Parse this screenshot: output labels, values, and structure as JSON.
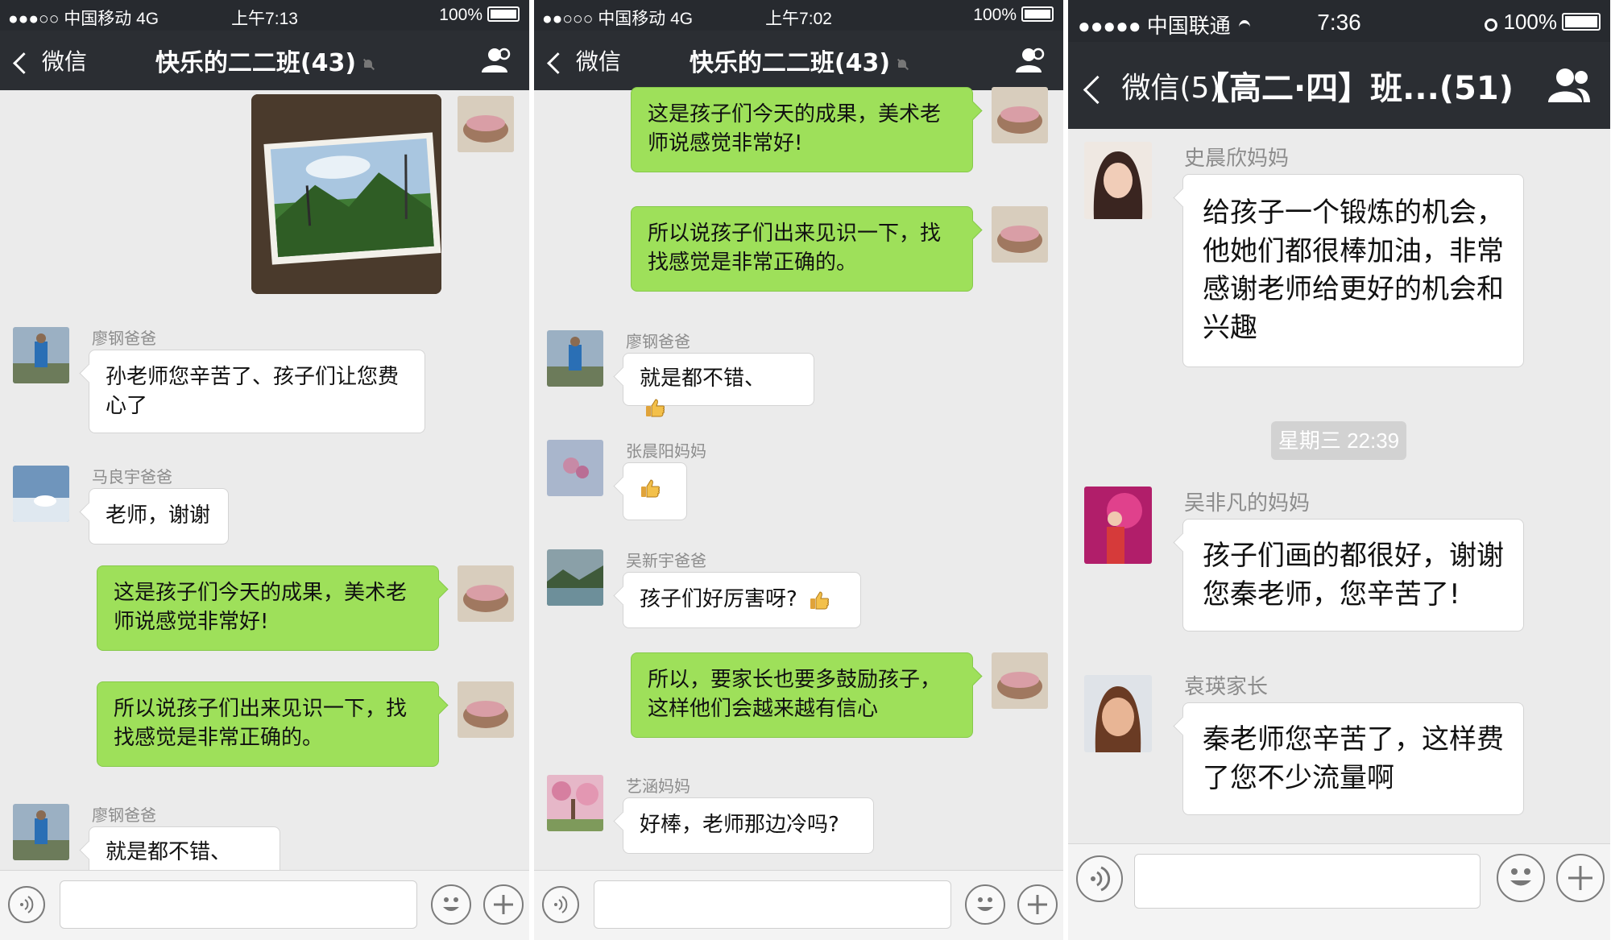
{
  "panels": [
    {
      "status": {
        "signal": "●●●○○ 中国移动",
        "network": "4G",
        "time": "上午7:13",
        "battery": "100%"
      },
      "nav": {
        "back_label": "微信",
        "title": "快乐的二二班(43)"
      },
      "messages": {
        "m2": {
          "sender": "廖钢爸爸",
          "text": "孙老师您辛苦了、孩子们让您费心了"
        },
        "m3": {
          "sender": "马良宇爸爸",
          "text": "老师，谢谢"
        },
        "m4": {
          "text": "这是孩子们今天的成果，美术老师说感觉非常好!"
        },
        "m5": {
          "text": "所以说孩子们出来见识一下，找找感觉是非常正确的。"
        },
        "m6": {
          "sender": "廖钢爸爸",
          "text": "就是都不错、"
        }
      }
    },
    {
      "status": {
        "signal": "●●○○○ 中国移动",
        "network": "4G",
        "time": "上午7:02",
        "battery": "100%"
      },
      "nav": {
        "back_label": "微信",
        "title": "快乐的二二班(43)"
      },
      "messages": {
        "m1": {
          "text": "这是孩子们今天的成果，美术老师说感觉非常好!"
        },
        "m2": {
          "text": "所以说孩子们出来见识一下，找找感觉是非常正确的。"
        },
        "m3": {
          "sender": "廖钢爸爸",
          "text": "就是都不错、"
        },
        "m4": {
          "sender": "张晨阳妈妈"
        },
        "m5": {
          "sender": "吴新宇爸爸",
          "text": "孩子们好厉害呀?"
        },
        "m6": {
          "text": "所以，要家长也要多鼓励孩子，这样他们会越来越有信心"
        },
        "m7": {
          "sender": "艺涵妈妈",
          "text": "好棒，老师那边冷吗?"
        }
      }
    },
    {
      "status": {
        "signal": "●●●●● 中国联通",
        "time": "7:36",
        "battery": "100%"
      },
      "nav": {
        "back_label": "微信(5)",
        "title": "【高二·四】班...(51)"
      },
      "messages": {
        "m1": {
          "sender": "史晨欣妈妈",
          "text": "给孩子一个锻炼的机会，他她们都很棒加油，非常感谢老师给更好的机会和兴趣"
        },
        "time_divider": "星期三 22:39",
        "m2": {
          "sender": "吴非凡的妈妈",
          "text": "孩子们画的都很好，谢谢您秦老师，您辛苦了!"
        },
        "m3": {
          "sender": "袁瑛家长",
          "text": "秦老师您辛苦了，这样费了您不少流量啊"
        }
      }
    }
  ],
  "colors": {
    "nav_bg": "#2b2e33",
    "chat_bg": "#ebebeb",
    "bubble_out": "#9ee05a",
    "bubble_in": "#ffffff"
  }
}
